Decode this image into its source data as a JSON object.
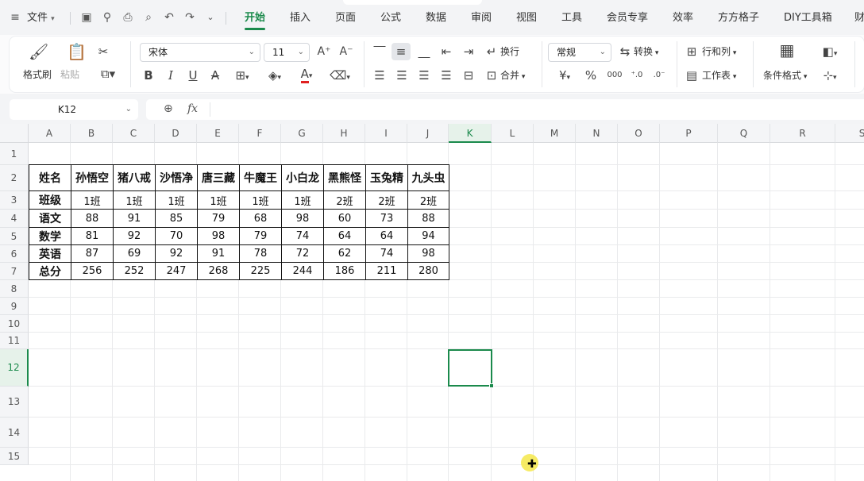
{
  "menubar": {
    "app_menu": "文件",
    "tabs": [
      "开始",
      "插入",
      "页面",
      "公式",
      "数据",
      "审阅",
      "视图",
      "工具",
      "会员专享",
      "效率",
      "方方格子",
      "DIY工具箱",
      "财"
    ],
    "active_tab": "开始"
  },
  "ribbon": {
    "format_painter": "格式刷",
    "paste": "粘贴",
    "font_name": "宋体",
    "font_size": "11",
    "wrap": "换行",
    "merge": "合并",
    "number_format": "常规",
    "convert": "转换",
    "rows_cols": "行和列",
    "worksheet": "工作表",
    "cond_format": "条件格式",
    "currency_symbol": "¥",
    "percent_symbol": "%"
  },
  "formula_bar": {
    "name_box": "K12",
    "fx": "fx",
    "content": ""
  },
  "sheet": {
    "columns": [
      "A",
      "B",
      "C",
      "D",
      "E",
      "F",
      "G",
      "H",
      "I",
      "J",
      "K",
      "L",
      "M",
      "N",
      "O",
      "P",
      "Q",
      "R",
      "S"
    ],
    "rows": [
      "1",
      "2",
      "3",
      "4",
      "5",
      "6",
      "7",
      "8",
      "9",
      "10",
      "11",
      "12",
      "13",
      "14",
      "15"
    ],
    "selected_col": "K",
    "selected_row": "12",
    "table": {
      "header": [
        "姓名",
        "孙悟空",
        "猪八戒",
        "沙悟净",
        "唐三藏",
        "牛魔王",
        "小白龙",
        "黑熊怪",
        "玉兔精",
        "九头虫"
      ],
      "rows": [
        [
          "班级",
          "1班",
          "1班",
          "1班",
          "1班",
          "1班",
          "1班",
          "2班",
          "2班",
          "2班"
        ],
        [
          "语文",
          "88",
          "91",
          "85",
          "79",
          "68",
          "98",
          "60",
          "73",
          "88"
        ],
        [
          "数学",
          "81",
          "92",
          "70",
          "98",
          "79",
          "74",
          "64",
          "64",
          "94"
        ],
        [
          "英语",
          "87",
          "69",
          "92",
          "91",
          "78",
          "72",
          "62",
          "74",
          "98"
        ],
        [
          "总分",
          "256",
          "252",
          "247",
          "268",
          "225",
          "244",
          "186",
          "211",
          "280"
        ]
      ]
    }
  },
  "colors": {
    "accent": "#1b8a4c",
    "font_color_bar": "#e02020"
  }
}
